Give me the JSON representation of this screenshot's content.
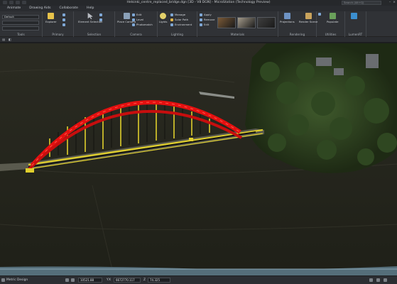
{
  "app": {
    "title": "Helsinki_centre_replaced_bridge.dgn [3D - V8 DGN] - MicroStation (Technology Preview)",
    "search_placeholder": "Search (Alt+Q)"
  },
  "menu": {
    "tabs": [
      "Animate",
      "Drawing Aids",
      "Collaborate",
      "Help"
    ]
  },
  "ribbon": {
    "tool_settings": {
      "combo_value": "Default",
      "label": "Tools"
    },
    "primary": {
      "explorer": "Explorer",
      "label": "Primary"
    },
    "selection": {
      "element_selection": "Element Selection",
      "label": "Selection"
    },
    "camera": {
      "place_camera": "Place Camera",
      "edit": "Edit",
      "level": "Level",
      "photomatch": "Photomatch",
      "label": "Camera"
    },
    "lighting": {
      "lights": "Lights",
      "manage": "Manage",
      "solar_path": "Solar Path",
      "environment": "Environment",
      "label": "Lighting"
    },
    "materials": {
      "apply": "Apply",
      "remove": "Remove",
      "edit": "Edit",
      "label": "Materials",
      "swatches": [
        "#7b5a37",
        "#a39a8a",
        "#3f3f3f"
      ]
    },
    "rendering": {
      "projections": "Projections",
      "render_scene": "Render Scene",
      "label": "Rendering"
    },
    "utilities": {
      "populate": "Populate",
      "label": "Utilities"
    },
    "lumenrt": {
      "label": "LumenRT"
    }
  },
  "statusbar": {
    "model": "Metric Design",
    "field_one": "10521.88",
    "x_value": "6672770.117",
    "z_value": "74.325",
    "x_label": "X",
    "y_label": "Y",
    "z_label": "Z"
  },
  "colors": {
    "arch": "#e41010",
    "deck_yellow": "#e0cf2c",
    "terrain": "#2a2a1f",
    "accent": "#3a78c2"
  }
}
